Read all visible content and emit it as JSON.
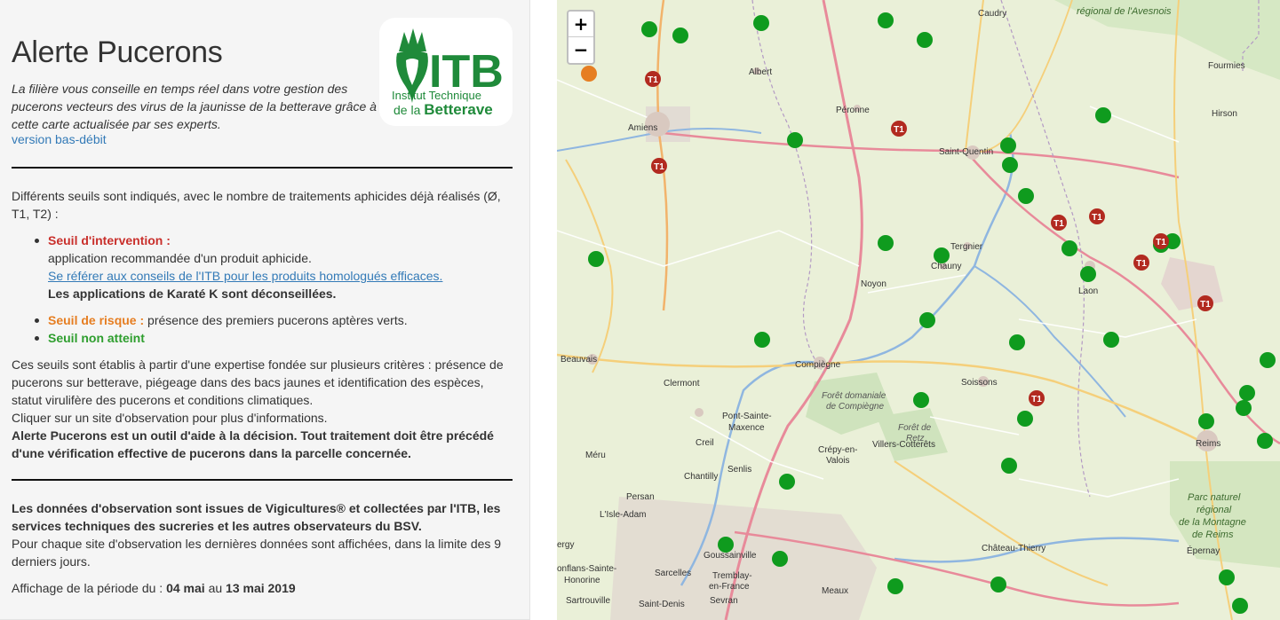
{
  "panel": {
    "title": "Alerte Pucerons",
    "intro": "La filière vous conseille en temps réel dans votre gestion des pucerons vecteurs des virus de la jaunisse de la betterave grâce à cette carte actualisée par ses experts.",
    "low_bandwidth_link": "version bas-débit",
    "logo": {
      "abbr": "ITB",
      "line1": "Institut Technique",
      "line2_prefix": "de la ",
      "line2_bold": "Betterave",
      "color": "#1f8a3a"
    },
    "thresholds_intro": "Différents seuils sont indiqués, avec le nombre de traitements aphicides déjà réalisés (Ø, T1, T2) :",
    "thresholds": {
      "intervention": {
        "label": "Seuil d'intervention :",
        "text": "application recommandée d'un produit aphicide.",
        "link": "Se référer aux conseils de l'ITB pour les produits homologués efficaces.",
        "warning": "Les applications de Karaté K sont déconseillées.",
        "color": "#c9302c"
      },
      "risk": {
        "label": "Seuil de risque :",
        "text": " présence des premiers pucerons aptères verts.",
        "color": "#e67e22"
      },
      "not_reached": {
        "label": "Seuil non atteint",
        "color": "#2e9e2e"
      }
    },
    "criteria_text": "Ces seuils sont établis à partir d'une expertise fondée sur plusieurs critères : présence de pucerons sur betterave, piégeage dans des bacs jaunes et identification des espèces, statut virulifère des pucerons et conditions climatiques.",
    "click_hint": "Cliquer sur un site d'observation pour plus d'informations.",
    "disclaimer": "Alerte Pucerons est un outil d'aide à la décision. Tout traitement doit être précédé d'une vérification effective de pucerons dans la parcelle concernée.",
    "data_source": "Les données d'observation sont issues de Vigicultures® et collectées par l'ITB, les services techniques des sucreries et les autres observateurs du BSV.",
    "data_window": "Pour chaque site d'observation les dernières données sont affichées, dans la limite des 9 derniers jours.",
    "period": {
      "prefix": "Affichage de la période du : ",
      "start": "04 mai",
      "middle": " au ",
      "end": "13 mai 2019"
    }
  },
  "map": {
    "zoom_in": "+",
    "zoom_out": "−",
    "marker_colors": {
      "not_reached": "#0f9b1e",
      "risk": "#e67e22",
      "intervention": "#b22a20"
    },
    "treatment_badge": "T1",
    "places": {
      "caudry": "Caudry",
      "avesnois_1": "régional de l'Avesnois",
      "albert": "Albert",
      "fourmies": "Fourmies",
      "peronne": "Péronne",
      "amiens": "Amiens",
      "hirson": "Hirson",
      "saint_quentin": "Saint-Quentin",
      "tergnier": "Tergnier",
      "chauny": "Chauny",
      "noyon": "Noyon",
      "laon": "Laon",
      "beauvais": "Beauvais",
      "compiegne": "Compiègne",
      "soissons": "Soissons",
      "clermont": "Clermont",
      "foret_compiegne_1": "Forêt domaniale",
      "foret_compiegne_2": "de Compiègne",
      "pont_1": "Pont-Sainte-",
      "pont_2": "Maxence",
      "foret_retz_1": "Forêt de",
      "foret_retz_2": "Retz",
      "villers": "Villers-Cotterêts",
      "creil": "Creil",
      "crepy_1": "Crépy-en-",
      "crepy_2": "Valois",
      "reims": "Reims",
      "meru": "Méru",
      "senlis": "Senlis",
      "chantilly": "Chantilly",
      "persan": "Persan",
      "park_1": "Parc naturel",
      "park_2": "régional",
      "park_3": "de la Montagne",
      "park_4": "de Reims",
      "isle_adam": "L'Isle-Adam",
      "cergy": "ergy",
      "goussainville": "Goussainville",
      "chateau_thierry": "Château-Thierry",
      "epernay": "Épernay",
      "conflans_1": "onflans-Sainte-",
      "conflans_2": "Honorine",
      "sarcelles": "Sarcelles",
      "tremblay_1": "Tremblay-",
      "tremblay_2": "en-France",
      "meaux": "Meaux",
      "sartrouville": "Sartrouville",
      "saint_denis": "Saint-Denis",
      "sevran": "Sevran"
    }
  }
}
